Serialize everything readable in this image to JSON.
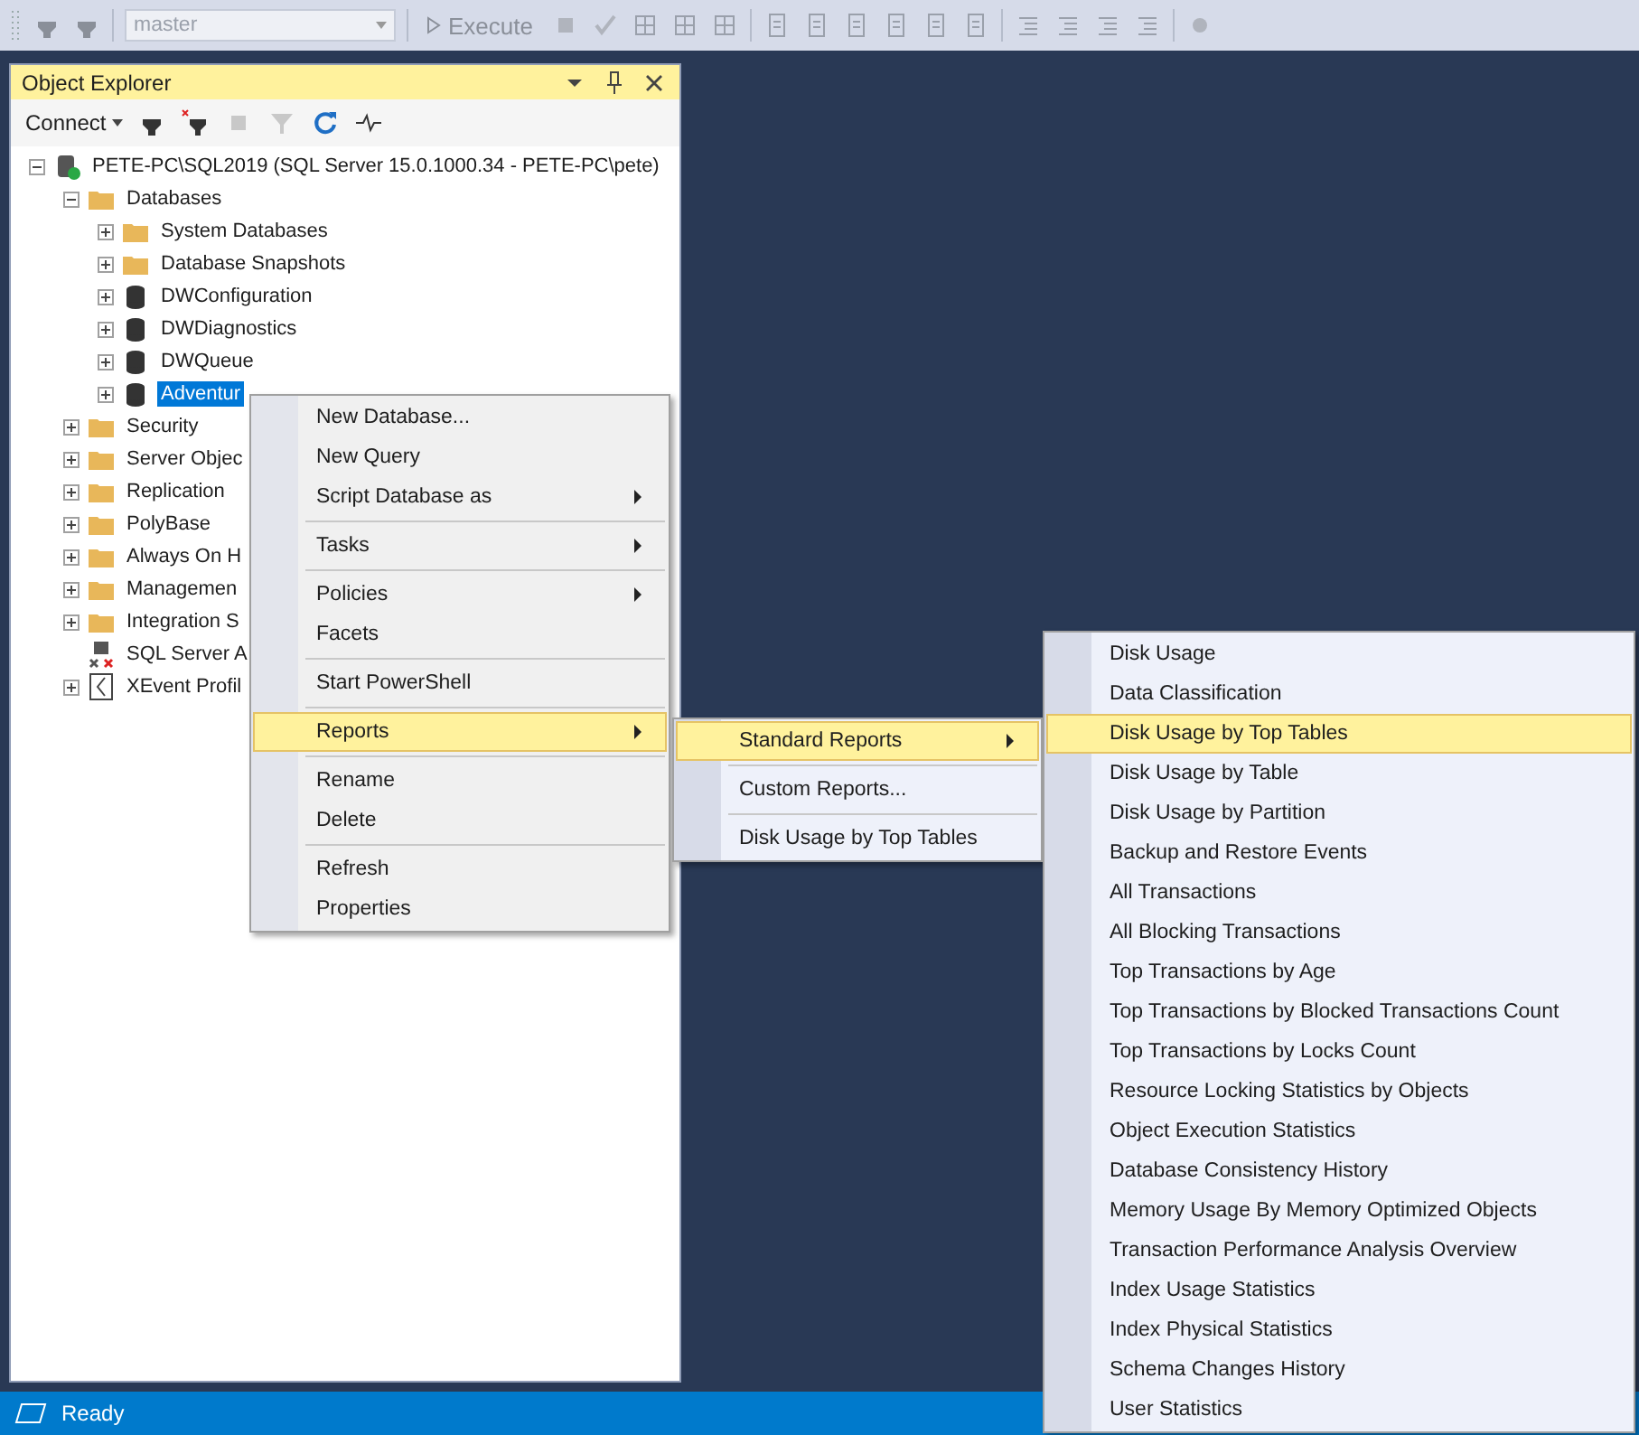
{
  "toolbar": {
    "database": "master",
    "execute": {
      "label": "Execute",
      "disabled": true
    }
  },
  "object_explorer": {
    "title": "Object Explorer",
    "connect": "Connect",
    "tree": [
      {
        "label": "PETE-PC\\SQL2019 (SQL Server 15.0.1000.34 - PETE-PC\\pete)",
        "kind": "server",
        "expanded": true,
        "selected": false,
        "children": [
          {
            "label": "Databases",
            "kind": "folder",
            "expanded": true,
            "selected": false,
            "children": [
              {
                "label": "System Databases",
                "kind": "folder",
                "expanded": false,
                "selected": false
              },
              {
                "label": "Database Snapshots",
                "kind": "folder",
                "expanded": false,
                "selected": false
              },
              {
                "label": "DWConfiguration",
                "kind": "database",
                "expanded": false,
                "selected": false
              },
              {
                "label": "DWDiagnostics",
                "kind": "database",
                "expanded": false,
                "selected": false
              },
              {
                "label": "DWQueue",
                "kind": "database",
                "expanded": false,
                "selected": false
              },
              {
                "label": "Adventur",
                "kind": "database",
                "expanded": false,
                "selected": true
              }
            ]
          },
          {
            "label": "Security",
            "kind": "folder",
            "expanded": false,
            "selected": false
          },
          {
            "label": "Server Objec",
            "kind": "folder",
            "expanded": false,
            "selected": false
          },
          {
            "label": "Replication",
            "kind": "folder",
            "expanded": false,
            "selected": false
          },
          {
            "label": "PolyBase",
            "kind": "folder",
            "expanded": false,
            "selected": false
          },
          {
            "label": "Always On H",
            "kind": "folder",
            "expanded": false,
            "selected": false
          },
          {
            "label": "Managemen",
            "kind": "folder",
            "expanded": false,
            "selected": false
          },
          {
            "label": "Integration S",
            "kind": "folder",
            "expanded": false,
            "selected": false
          },
          {
            "label": "SQL Server A",
            "kind": "agent",
            "selected": false
          },
          {
            "label": "XEvent Profil",
            "kind": "xevent",
            "expanded": false,
            "selected": false
          }
        ]
      }
    ]
  },
  "context_menu": [
    {
      "kind": "item",
      "label": "New Database...",
      "submenu": false,
      "selected": false
    },
    {
      "kind": "item",
      "label": "New Query",
      "submenu": false,
      "selected": false
    },
    {
      "kind": "item",
      "label": "Script Database as",
      "submenu": true,
      "selected": false
    },
    {
      "kind": "separator"
    },
    {
      "kind": "item",
      "label": "Tasks",
      "submenu": true,
      "selected": false
    },
    {
      "kind": "separator"
    },
    {
      "kind": "item",
      "label": "Policies",
      "submenu": true,
      "selected": false
    },
    {
      "kind": "item",
      "label": "Facets",
      "submenu": false,
      "selected": false
    },
    {
      "kind": "separator"
    },
    {
      "kind": "item",
      "label": "Start PowerShell",
      "submenu": false,
      "selected": false
    },
    {
      "kind": "separator"
    },
    {
      "kind": "item",
      "label": "Reports",
      "submenu": true,
      "selected": true
    },
    {
      "kind": "separator"
    },
    {
      "kind": "item",
      "label": "Rename",
      "submenu": false,
      "selected": false
    },
    {
      "kind": "item",
      "label": "Delete",
      "submenu": false,
      "selected": false
    },
    {
      "kind": "separator"
    },
    {
      "kind": "item",
      "label": "Refresh",
      "submenu": false,
      "selected": false
    },
    {
      "kind": "item",
      "label": "Properties",
      "submenu": false,
      "selected": false
    }
  ],
  "reports_menu": [
    {
      "kind": "item",
      "label": "Standard Reports",
      "submenu": true,
      "selected": true
    },
    {
      "kind": "separator"
    },
    {
      "kind": "item",
      "label": "Custom Reports...",
      "submenu": false,
      "selected": false
    },
    {
      "kind": "separator"
    },
    {
      "kind": "item",
      "label": "Disk Usage by Top Tables",
      "submenu": false,
      "selected": false
    }
  ],
  "standard_reports_menu": [
    {
      "kind": "item",
      "label": "Disk Usage",
      "selected": false
    },
    {
      "kind": "item",
      "label": "Data Classification",
      "selected": false
    },
    {
      "kind": "item",
      "label": "Disk Usage by Top Tables",
      "selected": true
    },
    {
      "kind": "item",
      "label": "Disk Usage by Table",
      "selected": false
    },
    {
      "kind": "item",
      "label": "Disk Usage by Partition",
      "selected": false
    },
    {
      "kind": "item",
      "label": "Backup and Restore Events",
      "selected": false
    },
    {
      "kind": "item",
      "label": "All Transactions",
      "selected": false
    },
    {
      "kind": "item",
      "label": "All Blocking Transactions",
      "selected": false
    },
    {
      "kind": "item",
      "label": "Top Transactions by Age",
      "selected": false
    },
    {
      "kind": "item",
      "label": "Top Transactions by Blocked Transactions Count",
      "selected": false
    },
    {
      "kind": "item",
      "label": "Top Transactions by Locks Count",
      "selected": false
    },
    {
      "kind": "item",
      "label": "Resource Locking Statistics by Objects",
      "selected": false
    },
    {
      "kind": "item",
      "label": "Object Execution Statistics",
      "selected": false
    },
    {
      "kind": "item",
      "label": "Database Consistency History",
      "selected": false
    },
    {
      "kind": "item",
      "label": "Memory Usage By Memory Optimized Objects",
      "selected": false
    },
    {
      "kind": "item",
      "label": "Transaction Performance Analysis Overview",
      "selected": false
    },
    {
      "kind": "item",
      "label": "Index Usage Statistics",
      "selected": false
    },
    {
      "kind": "item",
      "label": "Index Physical Statistics",
      "selected": false
    },
    {
      "kind": "item",
      "label": "Schema Changes History",
      "selected": false
    },
    {
      "kind": "item",
      "label": "User Statistics",
      "selected": false
    }
  ],
  "status_bar": {
    "text": "Ready"
  }
}
